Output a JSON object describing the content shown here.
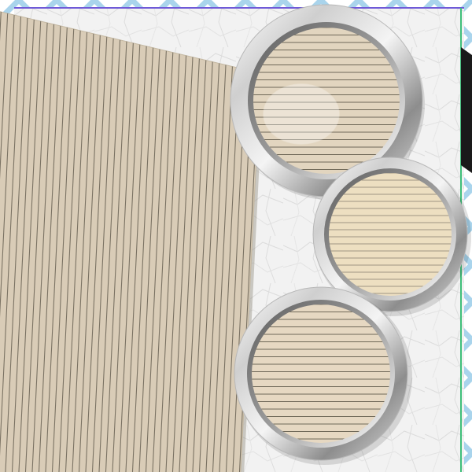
{
  "scene": {
    "description_free": true,
    "items": [
      {
        "kind": "lined-paper-sheet",
        "line_orientation": "vertical",
        "color": "#d8cbb6",
        "line_color": "#7a7263"
      },
      {
        "kind": "round-frame",
        "frame": "silver",
        "paper_color": "#e2d5bf",
        "line_orientation": "horizontal",
        "has_glass_highlight": true
      },
      {
        "kind": "round-frame",
        "frame": "silver",
        "paper_color": "#ead8b4",
        "line_orientation": "horizontal",
        "has_glass_highlight": true
      },
      {
        "kind": "round-frame",
        "frame": "silver",
        "paper_color": "#e6d8c2",
        "line_orientation": "horizontal",
        "has_glass_highlight": false
      }
    ]
  },
  "colors": {
    "background": "#eeeeee",
    "pattern_blue": "#a9d4ec",
    "border_purple": "#6f5ad8",
    "border_green": "#3fbf7a",
    "silver_light": "#f7f7f7",
    "silver_dark": "#8a8a8a"
  }
}
